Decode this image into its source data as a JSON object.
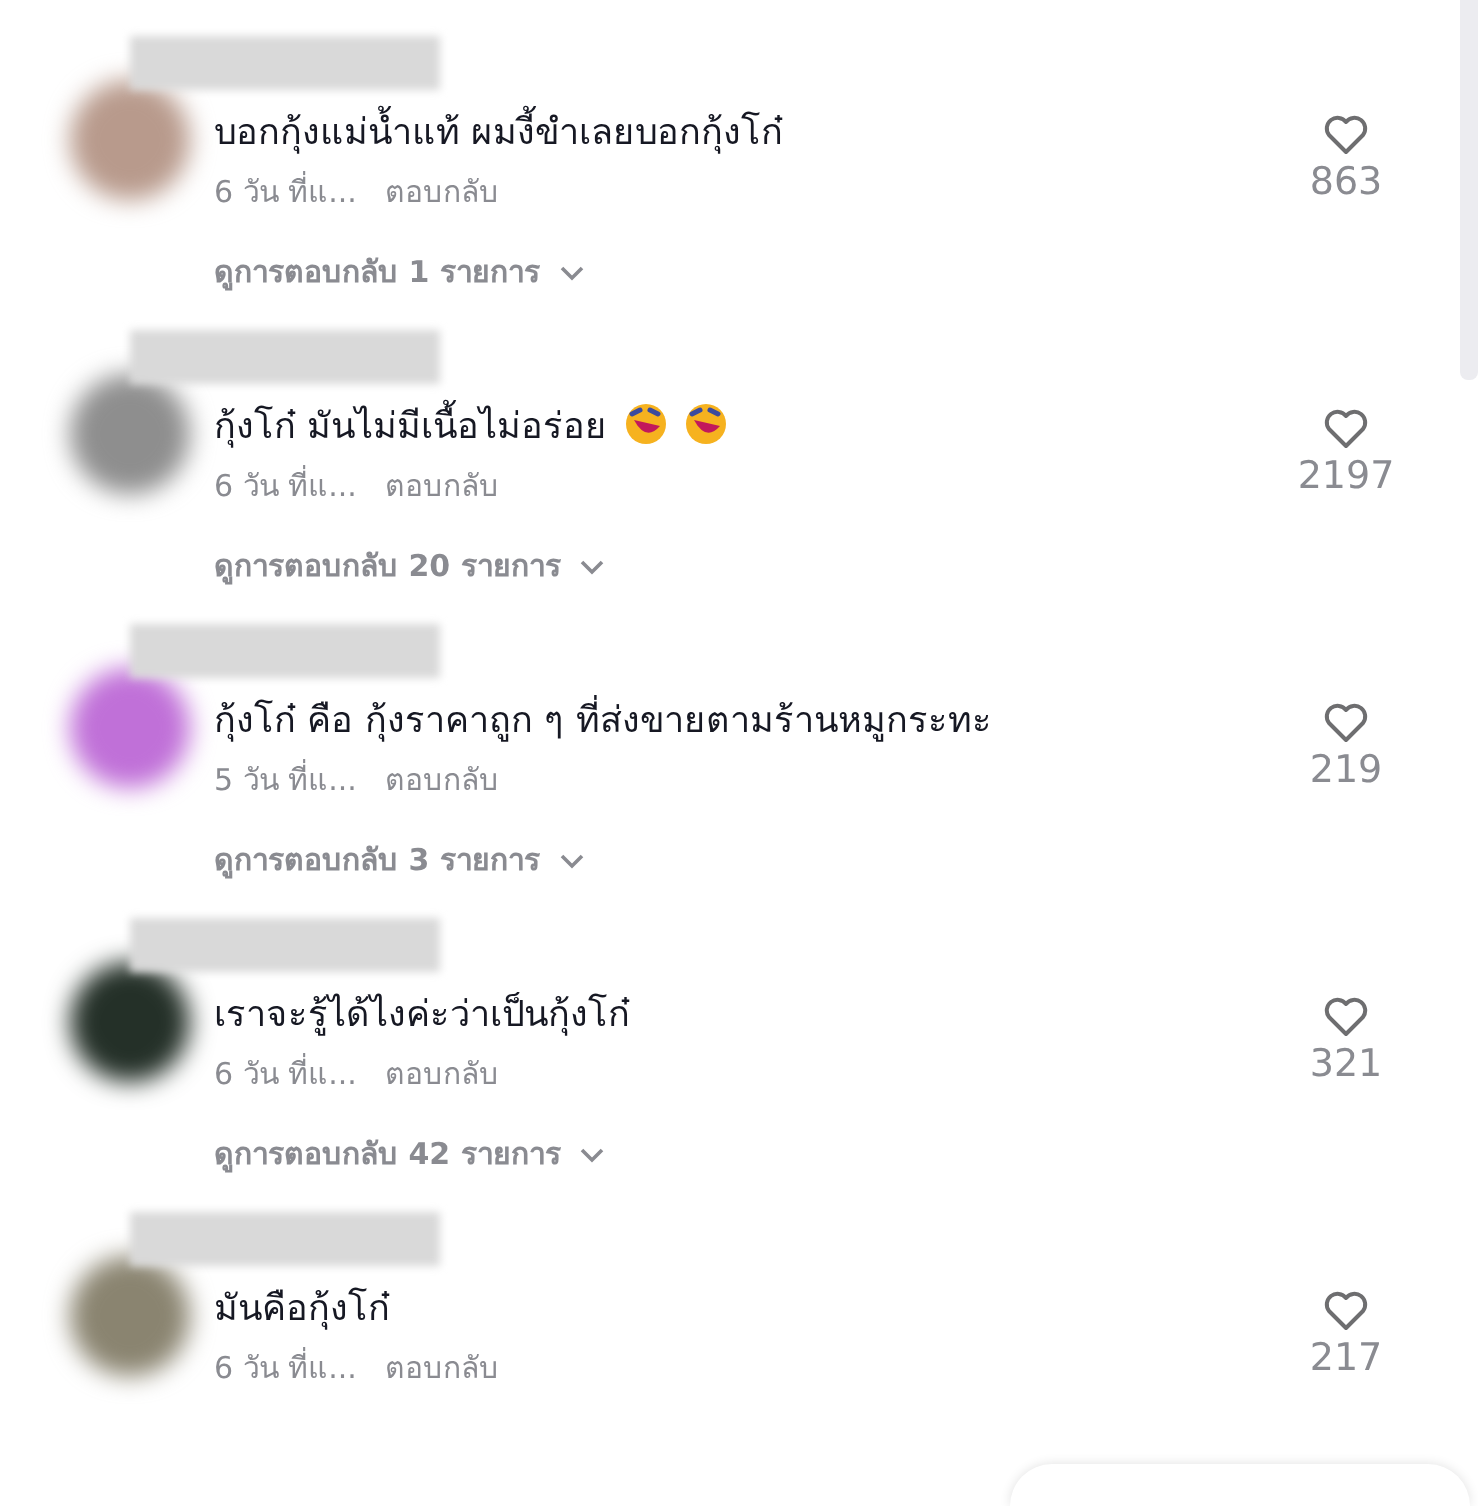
{
  "comments": [
    {
      "color": "#b89a8c",
      "text": "บอกกุ้งแม่น้ำแท้ ผมงี้ขำเลยบอกกุ้งโก๋",
      "time": "6 วัน ที่แ...",
      "reply": "ตอบกลับ",
      "likes": "863",
      "view_replies": "ดูการตอบกลับ 1 รายการ"
    },
    {
      "color": "#8e8e8e",
      "text": "กุ้งโก๋ มันไม่มีเนื้อไม่อร่อย",
      "emojis": [
        {
          "kind": "laughing"
        },
        {
          "kind": "laughing"
        }
      ],
      "time": "6 วัน ที่แ...",
      "reply": "ตอบกลับ",
      "likes": "2197",
      "view_replies": "ดูการตอบกลับ 20 รายการ"
    },
    {
      "color": "#c070d8",
      "text": "กุ้งโก๋ คือ กุ้งราคาถูก ๆ ที่ส่งขายตามร้านหมูกระทะ",
      "time": "5 วัน ที่แ...",
      "reply": "ตอบกลับ",
      "likes": "219",
      "view_replies": "ดูการตอบกลับ 3 รายการ"
    },
    {
      "color": "#243028",
      "text": "เราจะรู้ได้ไงค่ะว่าเป็นกุ้งโก๋",
      "time": "6 วัน ที่แ...",
      "reply": "ตอบกลับ",
      "likes": "321",
      "view_replies": "ดูการตอบกลับ 42 รายการ"
    },
    {
      "color": "#8a8470",
      "text": "มันคือกุ้งโก๋",
      "time": "6 วัน ที่แ...",
      "reply": "ตอบกลับ",
      "likes": "217"
    }
  ]
}
